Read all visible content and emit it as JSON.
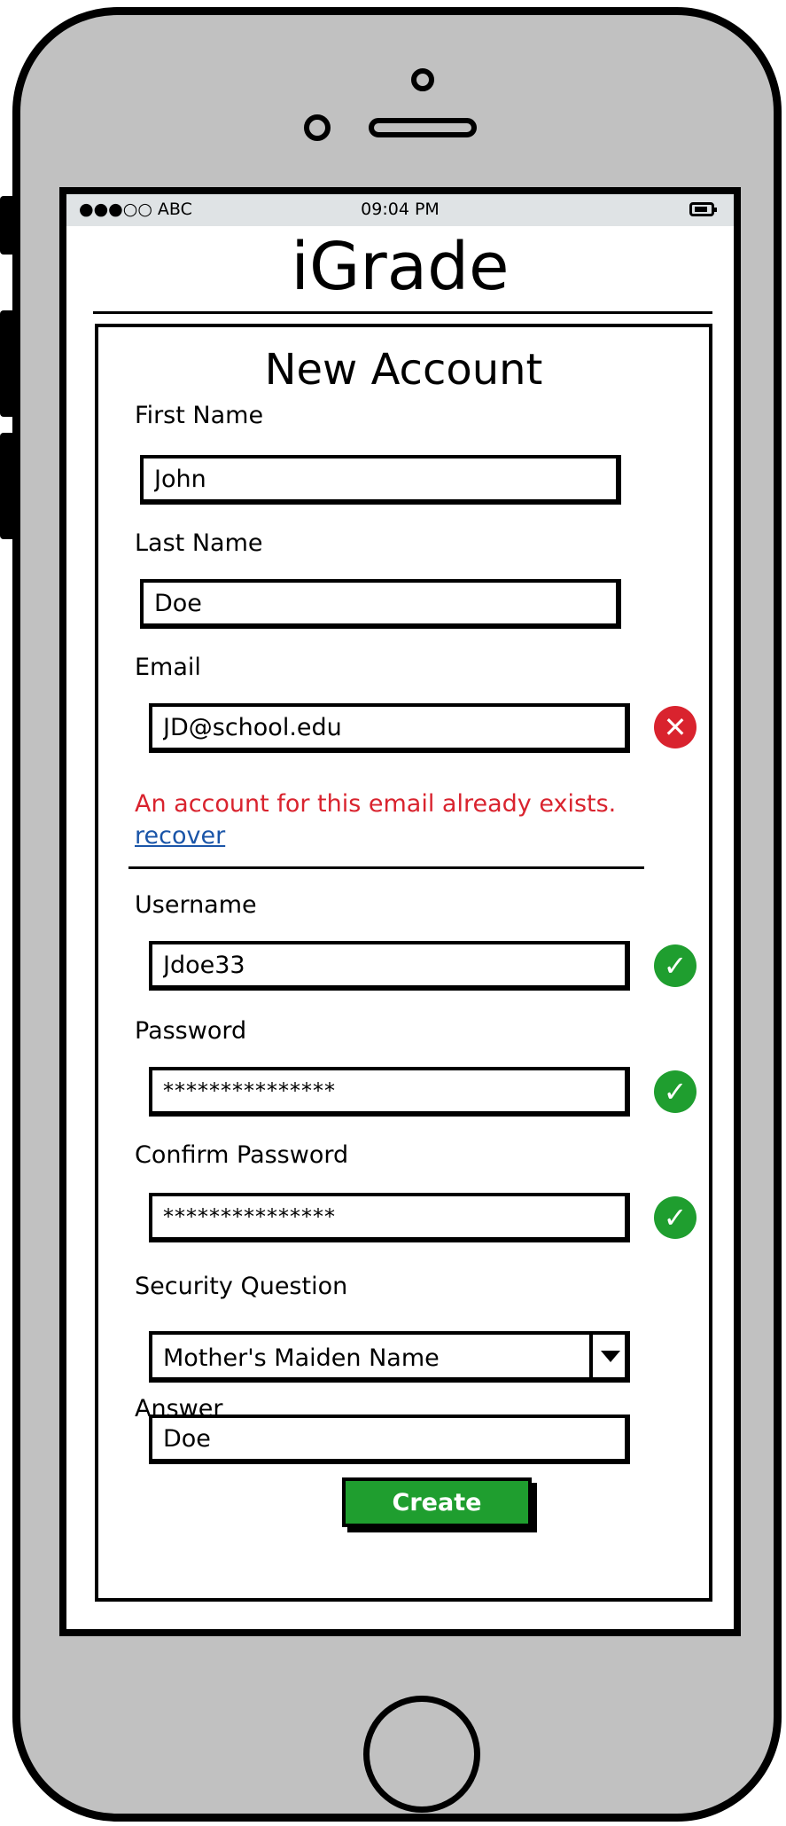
{
  "status_bar": {
    "carrier": "●●●○○ ABC",
    "time": "09:04 PM",
    "battery_icon": "battery-icon"
  },
  "app": {
    "title": "iGrade"
  },
  "form": {
    "title": "New Account",
    "first_name": {
      "label": "First Name",
      "value": "John"
    },
    "last_name": {
      "label": "Last Name",
      "value": "Doe"
    },
    "email": {
      "label": "Email",
      "value": "JD@school.edu",
      "status_icon": "error-x-icon",
      "error": "An account for this email already exists.",
      "recover_link": "recover"
    },
    "username": {
      "label": "Username",
      "value": "Jdoe33",
      "status_icon": "check-icon"
    },
    "password": {
      "label": "Password",
      "value": "***************",
      "status_icon": "check-icon"
    },
    "confirm_password": {
      "label": "Confirm Password",
      "value": "***************",
      "status_icon": "check-icon"
    },
    "security_question": {
      "label": "Security Question",
      "selected": "Mother's Maiden Name"
    },
    "answer": {
      "label": "Answer",
      "value": "Doe"
    },
    "create_label": "Create"
  },
  "colors": {
    "phone_body": "#c1c1c1",
    "status_bar": "#dfe3e5",
    "success_green": "#1f9e2f",
    "error_red": "#d9232e",
    "link_blue": "#1a55a8"
  }
}
